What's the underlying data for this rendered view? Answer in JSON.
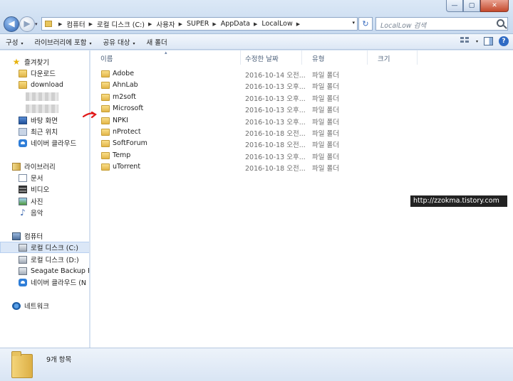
{
  "window": {
    "minimize": "—",
    "maximize": "▢",
    "close": "✕"
  },
  "nav": {
    "back": "◀",
    "forward": "▶",
    "dropdown": "▾"
  },
  "address": {
    "crumbs": [
      "컴퓨터",
      "로컬 디스크 (C:)",
      "사용자",
      "SUPER",
      "AppData",
      "LocalLow"
    ],
    "separator": "▶",
    "dropdown": "▾",
    "refresh": "↻"
  },
  "search": {
    "placeholder": "LocalLow 검색"
  },
  "toolbar": {
    "organize": "구성",
    "include_in_library": "라이브러리에 포함",
    "share_with": "공유 대상",
    "new_folder": "새 폴더",
    "caret": "▾",
    "help": "?"
  },
  "sidebar": {
    "favorites": "즐겨찾기",
    "downloads_kr": "다운로드",
    "download": "download",
    "desktop": "바탕 화면",
    "recent": "최근 위치",
    "naver_cloud": "네이버 클라우드",
    "libraries": "라이브러리",
    "documents": "문서",
    "videos": "비디오",
    "pictures": "사진",
    "music": "음악",
    "computer": "컴퓨터",
    "local_c": "로컬 디스크 (C:)",
    "local_d": "로컬 디스크 (D:)",
    "seagate": "Seagate Backup Plu",
    "naver_cloud_n": "네이버 클라우드 (N",
    "network": "네트워크"
  },
  "columns": {
    "name": "이름",
    "date": "수정한 날짜",
    "type": "유형",
    "size": "크기",
    "sort_indicator": "▴"
  },
  "files": [
    {
      "name": "Adobe",
      "date": "2016-10-14 오전...",
      "type": "파일 폴더"
    },
    {
      "name": "AhnLab",
      "date": "2016-10-13 오후...",
      "type": "파일 폴더"
    },
    {
      "name": "m2soft",
      "date": "2016-10-13 오후...",
      "type": "파일 폴더"
    },
    {
      "name": "Microsoft",
      "date": "2016-10-13 오후...",
      "type": "파일 폴더"
    },
    {
      "name": "NPKI",
      "date": "2016-10-13 오후...",
      "type": "파일 폴더"
    },
    {
      "name": "nProtect",
      "date": "2016-10-18 오전...",
      "type": "파일 폴더"
    },
    {
      "name": "SoftForum",
      "date": "2016-10-18 오전...",
      "type": "파일 폴더"
    },
    {
      "name": "Temp",
      "date": "2016-10-13 오후...",
      "type": "파일 폴더"
    },
    {
      "name": "uTorrent",
      "date": "2016-10-18 오전...",
      "type": "파일 폴더"
    }
  ],
  "watermark": "http://zzokma.tistory.com",
  "status": {
    "item_count": "9개 항목"
  },
  "colors": {
    "annotation_arrow": "#e11a1a",
    "selection": "#dbe7f7"
  }
}
